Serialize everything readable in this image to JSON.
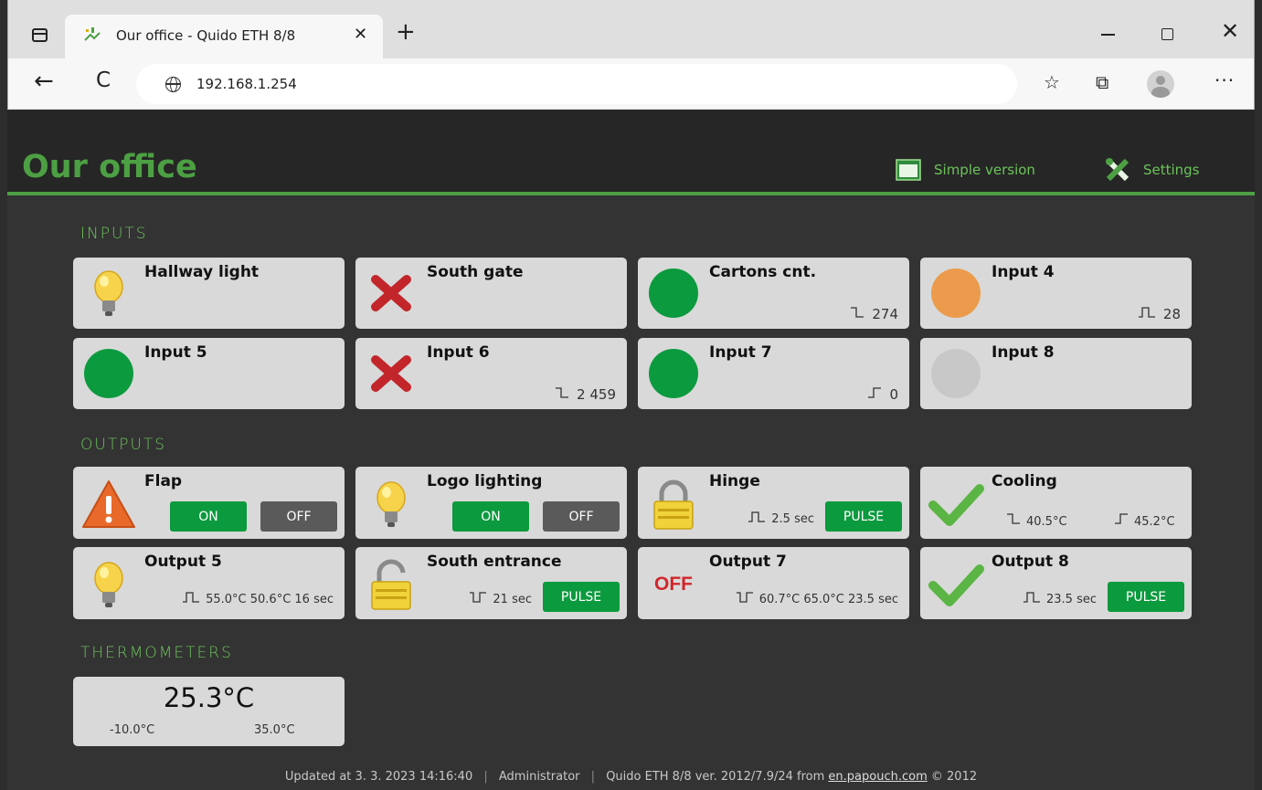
{
  "browser": {
    "tab_title": "Our office - Quido ETH 8/8",
    "tab_close": "✕",
    "new_tab": "+",
    "url": "192.168.1.254",
    "back": "←",
    "reload": "C",
    "more": "···",
    "close_window": "✕"
  },
  "header": {
    "title": "Our office",
    "simple_version": "Simple version",
    "settings": "Settings"
  },
  "inputs": {
    "label": "INPUTS",
    "items": [
      {
        "name": "Hallway light",
        "icon": "bulb-icon",
        "counter": ""
      },
      {
        "name": "South gate",
        "icon": "red-x-icon",
        "counter": ""
      },
      {
        "name": "Cartons cnt.",
        "icon": "green-dot-icon",
        "counter": "274",
        "edge": "falling-edge-icon"
      },
      {
        "name": "Input 4",
        "icon": "orange-dot-icon",
        "counter": "28",
        "edge": "pulse-edge-icon"
      },
      {
        "name": "Input 5",
        "icon": "green-dot-icon",
        "counter": ""
      },
      {
        "name": "Input 6",
        "icon": "red-x-icon",
        "counter": "2 459",
        "edge": "falling-edge-icon"
      },
      {
        "name": "Input 7",
        "icon": "green-dot-icon",
        "counter": "0",
        "edge": "rising-edge-icon"
      },
      {
        "name": "Input 8",
        "icon": "grey-dot-icon",
        "counter": ""
      }
    ]
  },
  "outputs": {
    "label": "OUTPUTS",
    "items": [
      {
        "name": "Flap",
        "icon": "warning-icon",
        "on": "ON",
        "off": "OFF"
      },
      {
        "name": "Logo lighting",
        "icon": "bulb-icon",
        "on": "ON",
        "off": "OFF"
      },
      {
        "name": "Hinge",
        "icon": "lock-closed-icon",
        "info": "2.5 sec",
        "pulse": "PULSE"
      },
      {
        "name": "Cooling",
        "icon": "checkmark-icon",
        "low": "40.5°C",
        "high": "45.2°C"
      },
      {
        "name": "Output 5",
        "icon": "bulb-icon",
        "info": "55.0°C 50.6°C 16 sec"
      },
      {
        "name": "South entrance",
        "icon": "lock-open-icon",
        "info": "21 sec",
        "pulse": "PULSE"
      },
      {
        "name": "Output 7",
        "icon": "off-text-icon",
        "icon_text": "OFF",
        "info": "60.7°C 65.0°C 23.5 sec"
      },
      {
        "name": "Output 8",
        "icon": "checkmark-icon",
        "info": "23.5 sec",
        "pulse": "PULSE"
      }
    ]
  },
  "thermometers": {
    "label": "THERMOMETERS",
    "items": [
      {
        "value": "25.3°C",
        "min": "-10.0°C",
        "max": "35.0°C"
      }
    ]
  },
  "footer": {
    "updated": "Updated at 3. 3. 2023 14:16:40",
    "user": "Administrator",
    "version_prefix": "Quido ETH 8/8 ver. 2012/7.9/24 from",
    "link": "en.papouch.com",
    "copyright": "© 2012",
    "separator": "|"
  },
  "colors": {
    "accent": "#4ca043",
    "green": "#0c9a3e",
    "background": "#333333",
    "card": "#d9d9d9"
  }
}
